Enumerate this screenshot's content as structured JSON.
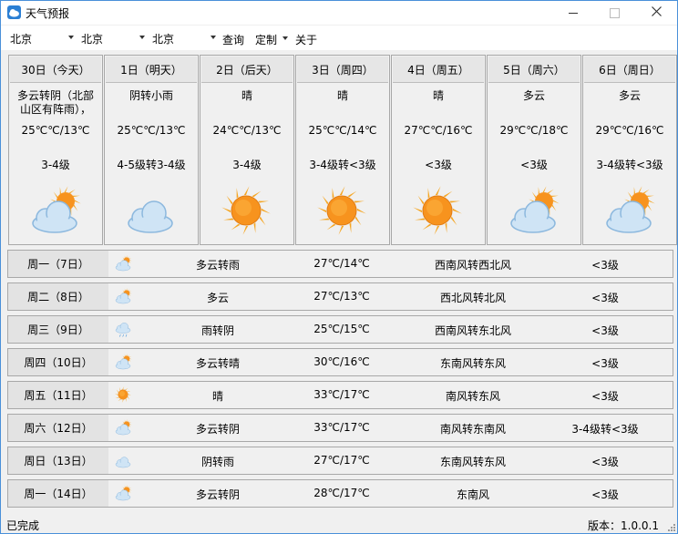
{
  "window": {
    "title": "天气预报"
  },
  "toolbar": {
    "province": "北京",
    "city": "北京",
    "district": "北京",
    "query": "查询",
    "customize": "定制",
    "about": "关于"
  },
  "days": [
    {
      "header": "30日（今天）",
      "condition": "多云转阴（北部山区有阵雨），",
      "temp": "25℃℃/13℃",
      "wind": "3-4级",
      "icon": "partly-cloudy-icon"
    },
    {
      "header": "1日（明天）",
      "condition": "阴转小雨",
      "temp": "25℃℃/13℃",
      "wind": "4-5级转3-4级",
      "icon": "cloudy-icon"
    },
    {
      "header": "2日（后天）",
      "condition": "晴",
      "temp": "24℃℃/13℃",
      "wind": "3-4级",
      "icon": "sunny-icon"
    },
    {
      "header": "3日（周四）",
      "condition": "晴",
      "temp": "25℃℃/14℃",
      "wind": "3-4级转<3级",
      "icon": "sunny-icon"
    },
    {
      "header": "4日（周五）",
      "condition": "晴",
      "temp": "27℃℃/16℃",
      "wind": "<3级",
      "icon": "sunny-icon"
    },
    {
      "header": "5日（周六）",
      "condition": "多云",
      "temp": "29℃℃/18℃",
      "wind": "<3级",
      "icon": "partly-cloudy-icon"
    },
    {
      "header": "6日（周日）",
      "condition": "多云",
      "temp": "29℃℃/16℃",
      "wind": "3-4级转<3级",
      "icon": "partly-cloudy-icon"
    }
  ],
  "week": [
    {
      "day": "周一（7日）",
      "condition": "多云转雨",
      "temp": "27℃/14℃",
      "wind": "西南风转西北风",
      "level": "<3级",
      "icon": "partly-cloudy-icon"
    },
    {
      "day": "周二（8日）",
      "condition": "多云",
      "temp": "27℃/13℃",
      "wind": "西北风转北风",
      "level": "<3级",
      "icon": "partly-cloudy-icon"
    },
    {
      "day": "周三（9日）",
      "condition": "雨转阴",
      "temp": "25℃/15℃",
      "wind": "西南风转东北风",
      "level": "<3级",
      "icon": "rain-icon"
    },
    {
      "day": "周四（10日）",
      "condition": "多云转晴",
      "temp": "30℃/16℃",
      "wind": "东南风转东风",
      "level": "<3级",
      "icon": "partly-cloudy-icon"
    },
    {
      "day": "周五（11日）",
      "condition": "晴",
      "temp": "33℃/17℃",
      "wind": "南风转东风",
      "level": "<3级",
      "icon": "sunny-icon"
    },
    {
      "day": "周六（12日）",
      "condition": "多云转阴",
      "temp": "33℃/17℃",
      "wind": "南风转东南风",
      "level": "3-4级转<3级",
      "icon": "partly-cloudy-icon"
    },
    {
      "day": "周日（13日）",
      "condition": "阴转雨",
      "temp": "27℃/17℃",
      "wind": "东南风转东风",
      "level": "<3级",
      "icon": "cloudy-icon"
    },
    {
      "day": "周一（14日）",
      "condition": "多云转阴",
      "temp": "28℃/17℃",
      "wind": "东南风",
      "level": "<3级",
      "icon": "partly-cloudy-icon"
    }
  ],
  "status": {
    "left": "已完成",
    "right": "版本：1.0.0.1"
  },
  "colors": {
    "sun": "#f5a623",
    "sun_core": "#f7931e",
    "cloud": "#cfe4f5",
    "cloud_edge": "#8cb8de",
    "accent": "#2b7fd4"
  }
}
